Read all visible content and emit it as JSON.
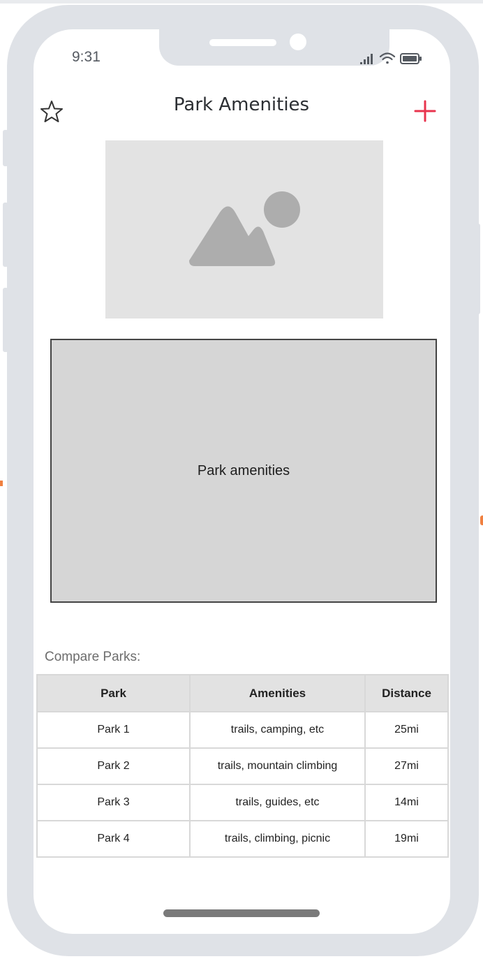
{
  "status_bar": {
    "time": "9:31"
  },
  "header": {
    "title": "Park Amenities",
    "left_icon": "star-icon",
    "right_icon": "plus-icon",
    "accent_color": "#e8344e"
  },
  "hero_image": {
    "icon": "image-placeholder-icon"
  },
  "amenities_panel": {
    "label": "Park amenities"
  },
  "compare": {
    "label": "Compare Parks:",
    "columns": [
      "Park",
      "Amenities",
      "Distance"
    ],
    "rows": [
      {
        "park": "Park 1",
        "amenities": "trails, camping, etc",
        "distance": "25mi"
      },
      {
        "park": "Park 2",
        "amenities": "trails, mountain climbing",
        "distance": "27mi"
      },
      {
        "park": "Park 3",
        "amenities": "trails, guides, etc",
        "distance": "14mi"
      },
      {
        "park": "Park 4",
        "amenities": "trails, climbing, picnic",
        "distance": "19mi"
      }
    ]
  }
}
